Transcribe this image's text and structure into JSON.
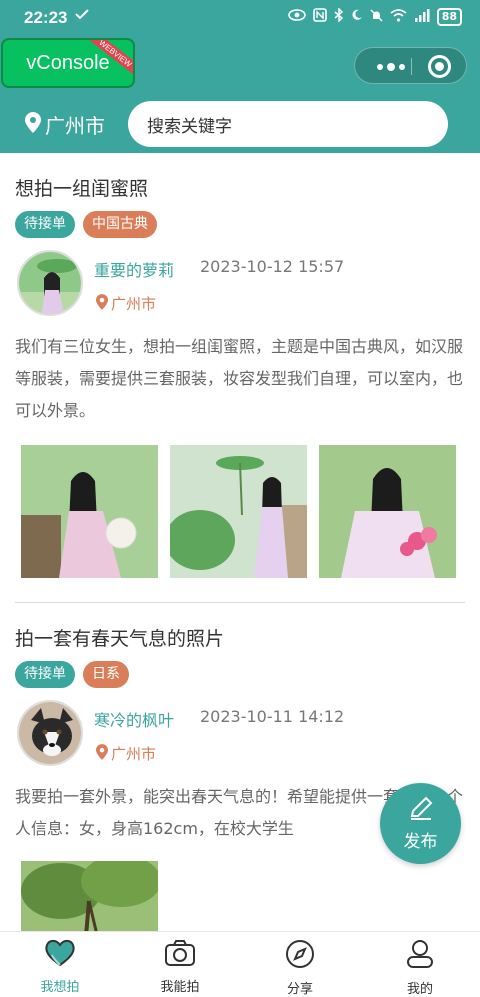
{
  "status_bar": {
    "time": "22:23",
    "battery": "88"
  },
  "vconsole": {
    "label": "vConsole",
    "ribbon": "WEBVIEW"
  },
  "location": {
    "city": "广州市"
  },
  "search": {
    "placeholder": "搜索关键字"
  },
  "posts": [
    {
      "title": "想拍一组闺蜜照",
      "status_tag": "待接单",
      "category_tag": "中国古典",
      "author": "重要的萝莉",
      "date": "2023-10-12 15:57",
      "location": "广州市",
      "description": "我们有三位女生，想拍一组闺蜜照，主题是中国古典风，如汉服等服装，需要提供三套服装，妆容发型我们自理，可以室内，也可以外景。"
    },
    {
      "title": "拍一套有春天气息的照片",
      "status_tag": "待接单",
      "category_tag": "日系",
      "author": "寒冷的枫叶",
      "date": "2023-10-11 14:12",
      "location": "广州市",
      "description": "我要拍一套外景，能突出春天气息的！希望能提供一套服装。个人信息：女，身高162cm，在校大学生"
    }
  ],
  "fab": {
    "label": "发布"
  },
  "tabs": [
    {
      "label": "我想拍",
      "icon": "heart-icon",
      "active": true
    },
    {
      "label": "我能拍",
      "icon": "camera-icon",
      "active": false
    },
    {
      "label": "分享",
      "icon": "compass-icon",
      "active": false
    },
    {
      "label": "我的",
      "icon": "user-icon",
      "active": false
    }
  ],
  "colors": {
    "primary": "#3aa69d",
    "accent": "#d97e59",
    "vconsole": "#07c160"
  }
}
